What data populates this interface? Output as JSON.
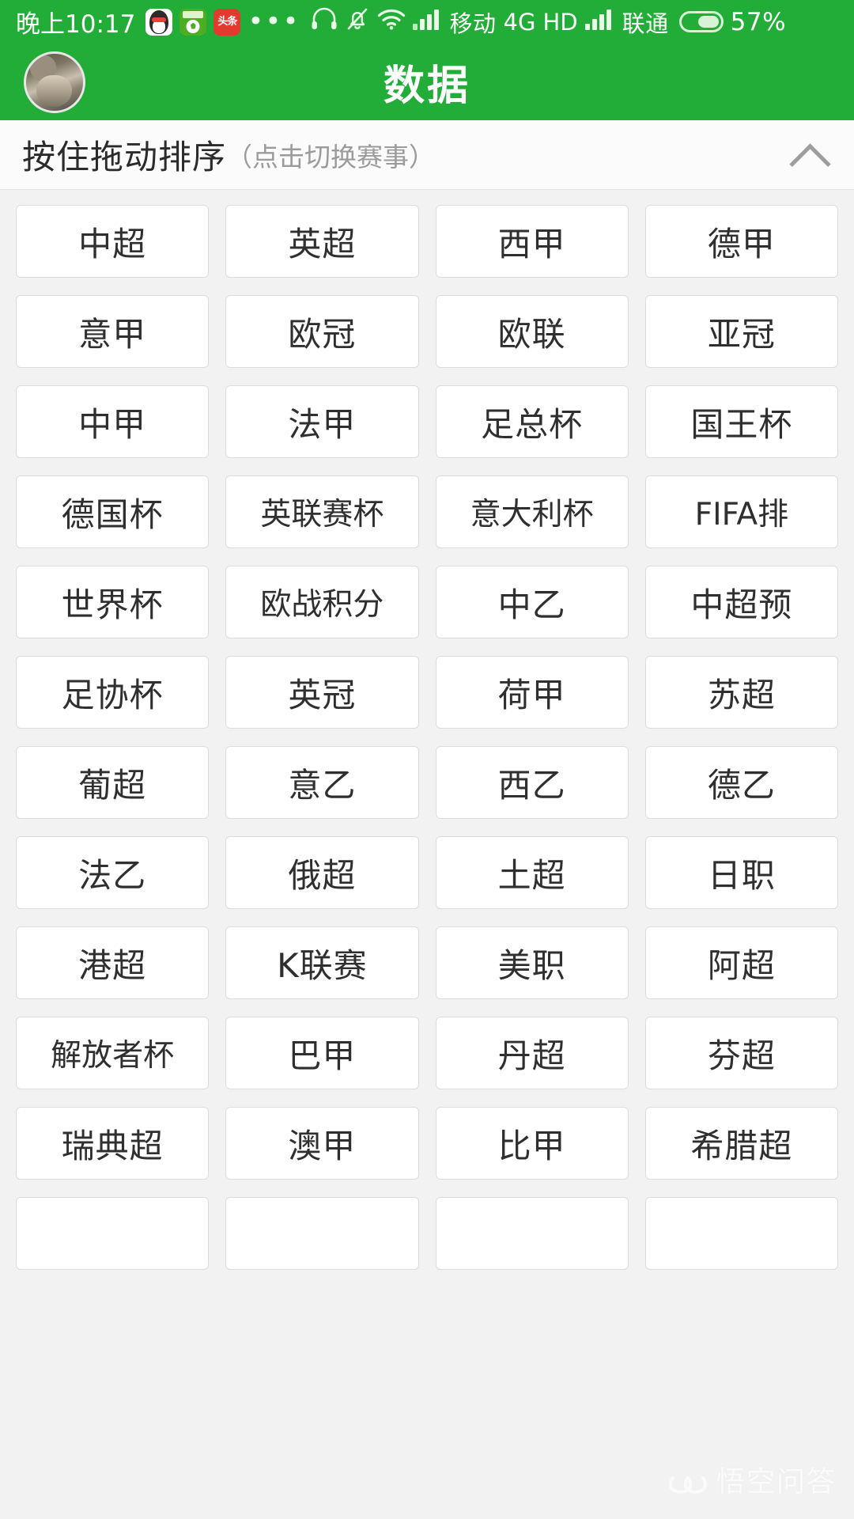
{
  "status_bar": {
    "time": "晚上10:17",
    "app_icons": [
      "qq-icon",
      "football-app-icon",
      "toutiao-icon"
    ],
    "overflow_label": "•••",
    "headset_icon": "headset-icon",
    "silent_icon": "bell-muted-icon",
    "wifi_icon": "wifi-icon",
    "signal1_icon": "signal-bars-icon",
    "carrier1": "移动",
    "network_type": "4G",
    "hd_label": "HD",
    "signal2_icon": "signal-bars-icon",
    "carrier2": "联通",
    "battery_icon": "battery-icon",
    "battery_percent": "57%"
  },
  "header": {
    "avatar": "user-avatar",
    "title": "数据"
  },
  "section": {
    "main_label": "按住拖动排序",
    "sub_label": "（点击切换赛事）",
    "collapse_icon": "chevron-up-icon"
  },
  "grid": {
    "columns": 4,
    "tiles": [
      "中超",
      "英超",
      "西甲",
      "德甲",
      "意甲",
      "欧冠",
      "欧联",
      "亚冠",
      "中甲",
      "法甲",
      "足总杯",
      "国王杯",
      "德国杯",
      "英联赛杯",
      "意大利杯",
      "FIFA排",
      "世界杯",
      "欧战积分",
      "中乙",
      "中超预",
      "足协杯",
      "英冠",
      "荷甲",
      "苏超",
      "葡超",
      "意乙",
      "西乙",
      "德乙",
      "法乙",
      "俄超",
      "土超",
      "日职",
      "港超",
      "K联赛",
      "美职",
      "阿超",
      "解放者杯",
      "巴甲",
      "丹超",
      "芬超",
      "瑞典超",
      "澳甲",
      "比甲",
      "希腊超",
      "",
      "",
      "",
      ""
    ]
  },
  "watermark": {
    "logo": "wukong-logo-icon",
    "text": "悟空问答"
  },
  "colors": {
    "brand_green": "#22ac38",
    "page_background": "#f2f2f2",
    "tile_background": "#ffffff",
    "tile_border": "#dcdcdc",
    "text_primary": "#2f2f2f",
    "text_muted": "#9b9b9b"
  }
}
